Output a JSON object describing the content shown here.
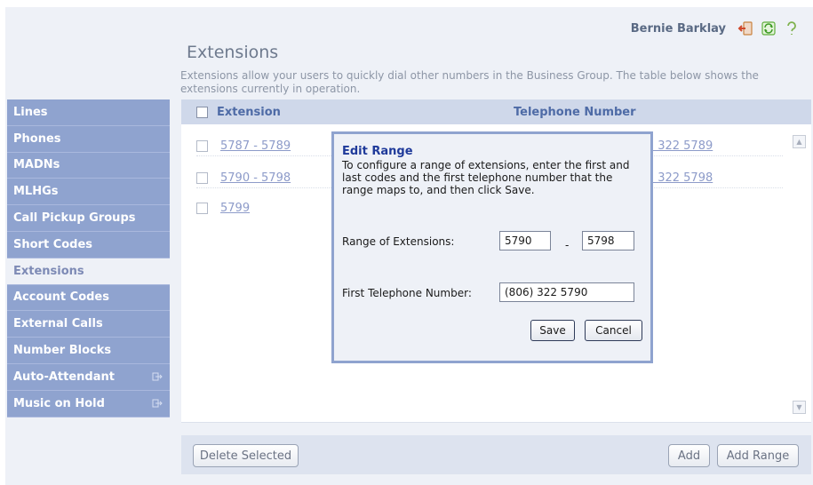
{
  "user": {
    "name": "Bernie Barklay"
  },
  "page": {
    "title": "Extensions",
    "intro": "Extensions allow your users to quickly dial other numbers in the Business Group. The table below shows the extensions currently in operation."
  },
  "sidebar": {
    "items": [
      {
        "label": "Lines"
      },
      {
        "label": "Phones"
      },
      {
        "label": "MADNs"
      },
      {
        "label": "MLHGs"
      },
      {
        "label": "Call Pickup Groups"
      },
      {
        "label": "Short Codes"
      },
      {
        "label": "Extensions",
        "active": true
      },
      {
        "label": "Account Codes"
      },
      {
        "label": "External Calls"
      },
      {
        "label": "Number Blocks"
      },
      {
        "label": "Auto-Attendant",
        "external": true
      },
      {
        "label": "Music on Hold",
        "external": true
      }
    ]
  },
  "table": {
    "headers": {
      "extension": "Extension",
      "telephone": "Telephone Number"
    },
    "rows": [
      {
        "extension": "5787 - 5789",
        "telephone": ") 322 5789"
      },
      {
        "extension": "5790 - 5798",
        "telephone": ") 322 5798"
      },
      {
        "extension": "5799",
        "telephone": ""
      }
    ]
  },
  "footer": {
    "delete_label": "Delete Selected",
    "add_label": "Add",
    "add_range_label": "Add Range"
  },
  "dialog": {
    "title": "Edit Range",
    "description": "To configure a range of extensions, enter the first and last codes and the first telephone number that the range maps to, and then click Save.",
    "range_label": "Range of Extensions:",
    "range_start": "5790",
    "range_separator": "-",
    "range_end": "5798",
    "first_number_label": "First Telephone Number:",
    "first_number": "(806) 322 5790",
    "save_label": "Save",
    "cancel_label": "Cancel"
  },
  "colors": {
    "sidebar_bg": "#8fa3cf",
    "header_text": "#4e6ba6",
    "link": "#8d9bc9",
    "dialog_title": "#1f3a9a"
  },
  "icons": [
    "logout-icon",
    "refresh-icon",
    "help-icon",
    "external-link-icon",
    "scroll-up-icon",
    "scroll-down-icon"
  ]
}
